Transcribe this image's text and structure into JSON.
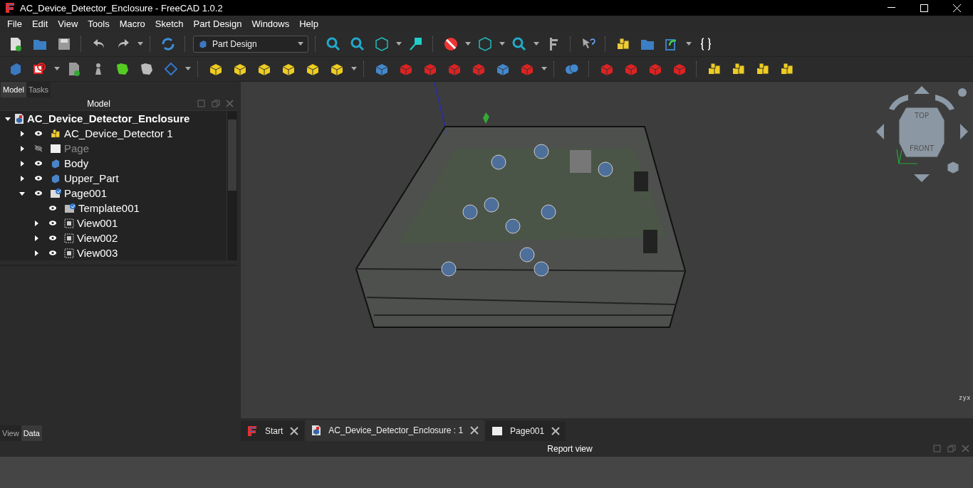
{
  "window": {
    "title": "AC_Device_Detector_Enclosure - FreeCAD 1.0.2"
  },
  "menu": [
    "File",
    "Edit",
    "View",
    "Tools",
    "Macro",
    "Sketch",
    "Part Design",
    "Windows",
    "Help"
  ],
  "workbench": {
    "value": "Part Design"
  },
  "left_tabs": [
    {
      "label": "Model",
      "selected": true
    },
    {
      "label": "Tasks",
      "selected": false
    }
  ],
  "panel_title": "Model",
  "tree": [
    {
      "label": "AC_Device_Detector_Enclosure",
      "kind": "document",
      "expanded": true,
      "children": [
        {
          "label": "AC_Device_Detector 1",
          "kind": "part",
          "visible": true,
          "expanded": false
        },
        {
          "label": "Page",
          "kind": "page",
          "visible": false,
          "expanded": false
        },
        {
          "label": "Body",
          "kind": "body",
          "visible": true,
          "expanded": false
        },
        {
          "label": "Upper_Part",
          "kind": "body",
          "visible": true,
          "expanded": false
        },
        {
          "label": "Page001",
          "kind": "page-checked",
          "visible": true,
          "expanded": true,
          "children": [
            {
              "label": "Template001",
              "kind": "template",
              "visible": true
            },
            {
              "label": "View001",
              "kind": "view",
              "visible": true,
              "expanded": false
            },
            {
              "label": "View002",
              "kind": "view",
              "visible": true,
              "expanded": false
            },
            {
              "label": "View003",
              "kind": "view",
              "visible": true,
              "expanded": false
            }
          ]
        }
      ]
    }
  ],
  "bottom_tabs": [
    {
      "label": "View",
      "selected": false
    },
    {
      "label": "Data",
      "selected": true
    }
  ],
  "navcube": {
    "top": "TOP",
    "front": "FRONT"
  },
  "axis_labels": [
    "z",
    "y",
    "x"
  ],
  "doc_tabs": [
    {
      "label": "Start",
      "kind": "start",
      "selected": false
    },
    {
      "label": "AC_Device_Detector_Enclosure : 1",
      "kind": "document",
      "selected": true
    },
    {
      "label": "Page001",
      "kind": "page",
      "selected": false
    }
  ],
  "report_view": {
    "title": "Report view"
  }
}
